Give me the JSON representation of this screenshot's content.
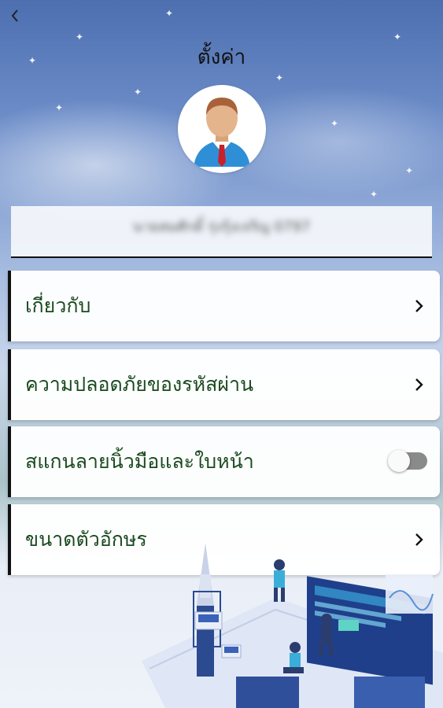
{
  "header": {
    "back_icon": "chevron-left-icon",
    "title": "ตั้งค่า"
  },
  "profile": {
    "avatar_icon": "user-avatar-icon",
    "name": "นายสมศักดิ์ รุ่งรุ้งเจริญ 0797"
  },
  "menu": {
    "items": [
      {
        "label": "เกี่ยวกับ",
        "control": "chevron-right-icon"
      },
      {
        "label": "ความปลอดภัยของรหัสผ่าน",
        "control": "chevron-right-icon"
      },
      {
        "label": "สแกนลายนิ้วมือและใบหน้า",
        "control": "toggle",
        "toggle_on": false
      },
      {
        "label": "ขนาดตัวอักษร",
        "control": "chevron-right-icon"
      }
    ]
  },
  "colors": {
    "label_text": "#1a4a1f",
    "accent_bar": "#111111",
    "toggle_off": "#8a8a8a"
  }
}
